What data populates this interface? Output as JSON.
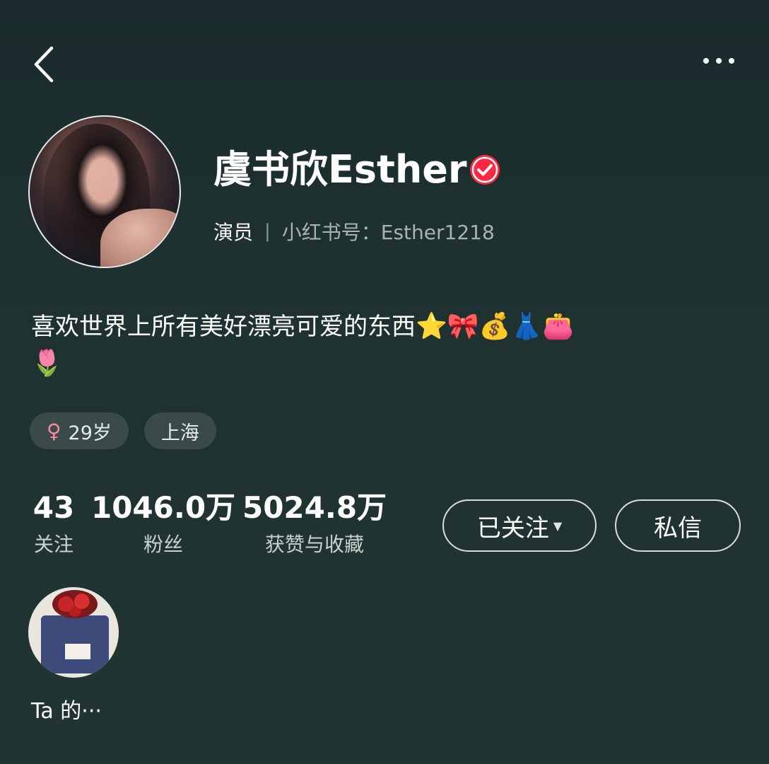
{
  "header": {
    "back_icon": "chevron-left-icon",
    "more_icon": "more-dots-icon"
  },
  "profile": {
    "name": "虞书欣Esther",
    "verified_icon": "verified-badge-icon",
    "verified_color": "#ff2741",
    "role": "演员",
    "separator": "|",
    "red_id": "小红书号：Esther1218",
    "bio_text": "喜欢世界上所有美好漂亮可爱的东西",
    "bio_emojis": [
      "⭐",
      "🎀",
      "💰",
      "👗",
      "👛",
      "🌷"
    ]
  },
  "tags": {
    "gender_symbol": "♀",
    "age": "29岁",
    "location": "上海"
  },
  "stats": [
    {
      "value": "43",
      "label": "关注"
    },
    {
      "value": "1046.0万",
      "label": "粉丝"
    },
    {
      "value": "5024.8万",
      "label": "获赞与收藏"
    }
  ],
  "actions": {
    "follow_label": "已关注",
    "follow_caret": "▼",
    "message_label": "私信"
  },
  "collection": {
    "label": "Ta 的···"
  }
}
